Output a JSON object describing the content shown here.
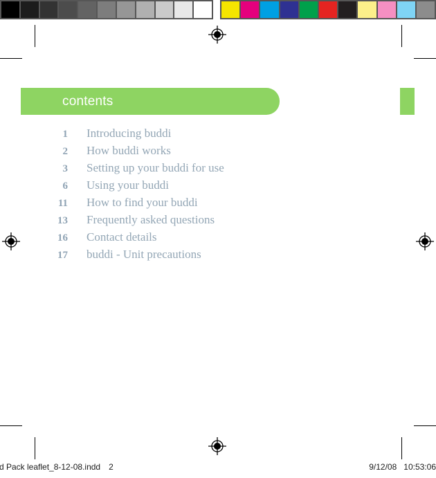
{
  "calibration": {
    "grayscale_label": "grayscale-step-wedge",
    "grayscale_swatches": [
      "#000000",
      "#1c1c1c",
      "#333333",
      "#4c4c4c",
      "#636363",
      "#7d7d7d",
      "#969696",
      "#b0b0b0",
      "#cacaca",
      "#e8e8e8",
      "#ffffff"
    ],
    "color_label": "color-control-bar",
    "color_swatches": [
      "#f5e500",
      "#e5007d",
      "#00a0e3",
      "#2e3192",
      "#00a04b",
      "#e52421",
      "#231f20",
      "#fcf08a",
      "#f happy",
      "#7fd4f5",
      "#8c8c8c"
    ],
    "color_swatches_fixed": [
      "#f5e500",
      "#e5007d",
      "#00a0e3",
      "#2e3192",
      "#00a04b",
      "#e52421",
      "#231f20",
      "#fcf08a",
      "#f58fc2",
      "#7fd4f5",
      "#8c8c8c"
    ]
  },
  "marks": {
    "registration_mark_name": "registration-target",
    "crop_mark_name": "crop-mark"
  },
  "page": {
    "banner": {
      "title": "contents",
      "background_color": "#8ed462",
      "text_color": "#ffffff"
    },
    "side_tab": {
      "color": "#8ed462"
    },
    "toc": {
      "number_color": "#8fa3b4",
      "label_color": "#93a6b5",
      "items": [
        {
          "page": "1",
          "label": "Introducing buddi"
        },
        {
          "page": "2",
          "label": "How buddi works"
        },
        {
          "page": "3",
          "label": "Setting up your buddi for use"
        },
        {
          "page": "6",
          "label": "Using your buddi"
        },
        {
          "page": "11",
          "label": "How to find your buddi"
        },
        {
          "page": "13",
          "label": "Frequently asked questions"
        },
        {
          "page": "16",
          "label": "Contact details"
        },
        {
          "page": "17",
          "label": "buddi - Unit precautions"
        }
      ]
    }
  },
  "footer": {
    "file_name": "d Pack leaflet_8-12-08.indd",
    "page_number": "2",
    "date": "9/12/08",
    "time": "10:53:06"
  }
}
